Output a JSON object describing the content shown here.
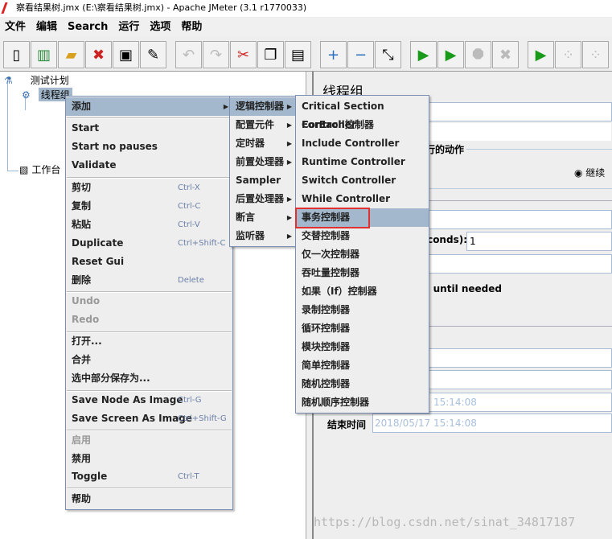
{
  "window": {
    "title": "察看结果树.jmx (E:\\察看结果树.jmx) - Apache JMeter (3.1 r1770033)"
  },
  "menubar": [
    "文件",
    "编辑",
    "Search",
    "运行",
    "选项",
    "帮助"
  ],
  "toolbar": [
    {
      "icon": "new-icon",
      "glyph": "▯",
      "enabled": true
    },
    {
      "icon": "templates-icon",
      "glyph": "▥",
      "enabled": true
    },
    {
      "icon": "open-icon",
      "glyph": "▰",
      "enabled": true
    },
    {
      "icon": "close-icon",
      "glyph": "✖",
      "enabled": true
    },
    {
      "icon": "save-icon",
      "glyph": "▣",
      "enabled": true
    },
    {
      "icon": "save-as-icon",
      "glyph": "✎",
      "enabled": true
    },
    {
      "icon": "undo-icon",
      "glyph": "↶",
      "enabled": false
    },
    {
      "icon": "redo-icon",
      "glyph": "↷",
      "enabled": false
    },
    {
      "icon": "cut-icon",
      "glyph": "✂",
      "enabled": true
    },
    {
      "icon": "copy-icon",
      "glyph": "❐",
      "enabled": true
    },
    {
      "icon": "paste-icon",
      "glyph": "▤",
      "enabled": true
    },
    {
      "icon": "expand-icon",
      "glyph": "+",
      "enabled": true
    },
    {
      "icon": "collapse-icon",
      "glyph": "−",
      "enabled": true
    },
    {
      "icon": "toggle-icon",
      "glyph": "⤡",
      "enabled": true
    },
    {
      "icon": "start-icon",
      "glyph": "▶",
      "enabled": true
    },
    {
      "icon": "start-no-pauses-icon",
      "glyph": "▶",
      "enabled": true
    },
    {
      "icon": "stop-icon",
      "glyph": "⯃",
      "enabled": false
    },
    {
      "icon": "shutdown-icon",
      "glyph": "✖",
      "enabled": false
    },
    {
      "icon": "remote-start-all-icon",
      "glyph": "▶",
      "enabled": true
    },
    {
      "icon": "remote-stop-all-icon",
      "glyph": "⁘",
      "enabled": false
    },
    {
      "icon": "remote-shutdown-all-icon",
      "glyph": "⁘",
      "enabled": false
    }
  ],
  "tree": {
    "test_plan": "测试计划",
    "thread_group": "线程组",
    "workbench": "工作台"
  },
  "context_menu": {
    "add": "添加",
    "start": "Start",
    "start_no_pauses": "Start no pauses",
    "validate": "Validate",
    "cut": "剪切",
    "cut_sc": "Ctrl-X",
    "copy": "复制",
    "copy_sc": "Ctrl-C",
    "paste": "粘贴",
    "paste_sc": "Ctrl-V",
    "duplicate": "Duplicate",
    "duplicate_sc": "Ctrl+Shift-C",
    "reset_gui": "Reset Gui",
    "delete": "删除",
    "delete_sc": "Delete",
    "undo": "Undo",
    "redo": "Redo",
    "open": "打开...",
    "merge": "合并",
    "save_selection": "选中部分保存为...",
    "save_node_image": "Save Node As Image",
    "save_node_image_sc": "Ctrl-G",
    "save_screen_image": "Save Screen As Image",
    "save_screen_image_sc": "Ctrl+Shift-G",
    "enable": "启用",
    "disable": "禁用",
    "toggle": "Toggle",
    "toggle_sc": "Ctrl-T",
    "help": "帮助"
  },
  "add_submenu": [
    "逻辑控制器",
    "配置元件",
    "定时器",
    "前置处理器",
    "Sampler",
    "后置处理器",
    "断言",
    "监听器"
  ],
  "logic_submenu": [
    "Critical Section Controller",
    "ForEach控制器",
    "Include Controller",
    "Runtime Controller",
    "Switch Controller",
    "While Controller",
    "事务控制器",
    "交替控制器",
    "仅一次控制器",
    "吞吐量控制器",
    "如果（If）控制器",
    "录制控制器",
    "循环控制器",
    "模块控制器",
    "简单控制器",
    "随机控制器",
    "随机顺序控制器"
  ],
  "logic_submenu_selected": "事务控制器",
  "panel": {
    "title": "线程组",
    "error_action_label": "在取样器错误后要执行的动作",
    "continue_label": "继续",
    "rampup_label": "Ramp-Up Period (in seconds):",
    "rampup_value": "1",
    "delay_label": "Delay Thread creation until needed",
    "start_time_value": "2018/05/17 15:14:08",
    "end_time_label": "结束时间",
    "end_time_value": "2018/05/17 15:14:08"
  },
  "watermark": "https://blog.csdn.net/sinat_34817187",
  "colors": {
    "highlight": "#a3b8cc",
    "annotation_box": "#e03030"
  }
}
